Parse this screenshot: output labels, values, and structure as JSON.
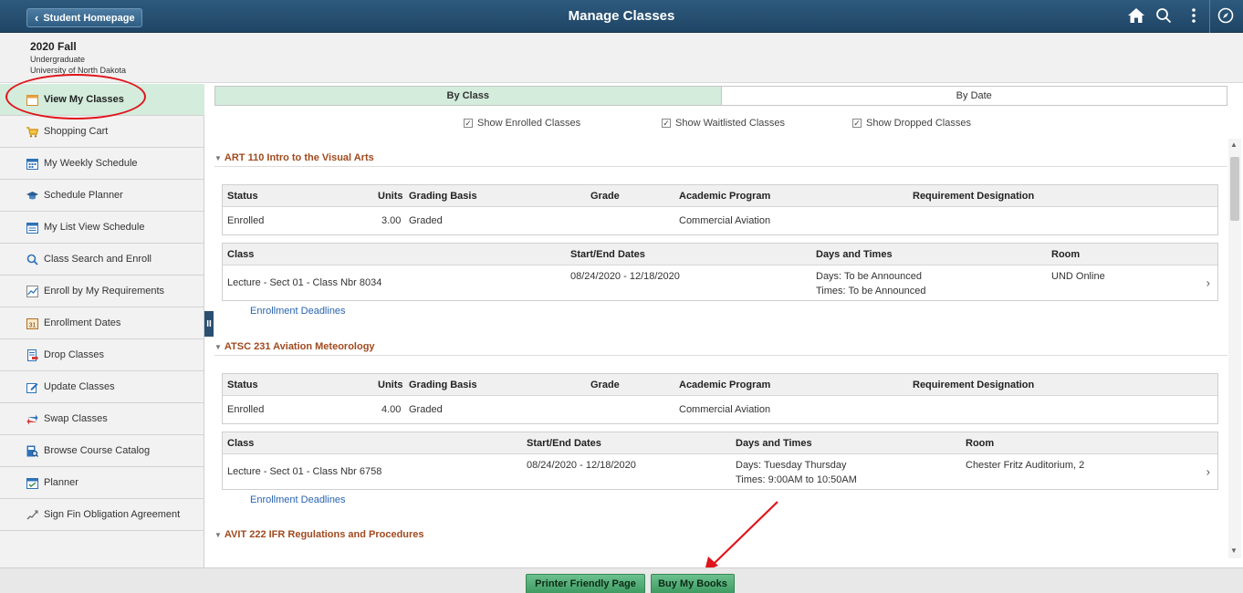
{
  "header": {
    "back_label": "Student Homepage",
    "title": "Manage Classes",
    "icons": [
      "home-icon",
      "search-icon",
      "more-vert-icon",
      "compass-icon"
    ]
  },
  "term": {
    "title": "2020 Fall",
    "career": "Undergraduate",
    "institution": "University of North Dakota"
  },
  "sidebar": {
    "items": [
      {
        "label": "View My Classes",
        "icon": "calendar-icon",
        "active": true
      },
      {
        "label": "Shopping Cart",
        "icon": "cart-icon"
      },
      {
        "label": "My Weekly Schedule",
        "icon": "calendar-grid-icon"
      },
      {
        "label": "Schedule Planner",
        "icon": "cap-icon"
      },
      {
        "label": "My List View Schedule",
        "icon": "calendar-list-icon"
      },
      {
        "label": "Class Search and Enroll",
        "icon": "search-icon"
      },
      {
        "label": "Enroll by My Requirements",
        "icon": "chart-line-icon"
      },
      {
        "label": "Enrollment Dates",
        "icon": "date-icon"
      },
      {
        "label": "Drop Classes",
        "icon": "drop-icon"
      },
      {
        "label": "Update Classes",
        "icon": "edit-icon"
      },
      {
        "label": "Swap Classes",
        "icon": "swap-icon"
      },
      {
        "label": "Browse Course Catalog",
        "icon": "catalog-icon"
      },
      {
        "label": "Planner",
        "icon": "planner-icon"
      },
      {
        "label": "Sign Fin Obligation Agreement",
        "icon": "sign-icon"
      }
    ]
  },
  "tabs": [
    {
      "label": "By Class",
      "active": true
    },
    {
      "label": "By Date",
      "active": false
    }
  ],
  "filters": [
    {
      "label": "Show Enrolled Classes",
      "checked": true
    },
    {
      "label": "Show Waitlisted Classes",
      "checked": true
    },
    {
      "label": "Show Dropped Classes",
      "checked": true
    }
  ],
  "status_headers": {
    "status": "Status",
    "units": "Units",
    "grading": "Grading Basis",
    "grade": "Grade",
    "program": "Academic Program",
    "requirement": "Requirement Designation"
  },
  "class_headers": {
    "class": "Class",
    "dates": "Start/End Dates",
    "days": "Days and Times",
    "room": "Room"
  },
  "courses": [
    {
      "title": "ART 110 Intro to the Visual Arts",
      "status": "Enrolled",
      "units": "3.00",
      "grading": "Graded",
      "grade": "",
      "program": "Commercial Aviation",
      "requirement": "",
      "class": "Lecture - Sect 01 - Class Nbr 8034",
      "dates": "08/24/2020 - 12/18/2020",
      "days": "Days: To be Announced",
      "times": "Times: To be Announced",
      "room": "UND Online",
      "link": "Enrollment Deadlines"
    },
    {
      "title": "ATSC 231 Aviation Meteorology",
      "status": "Enrolled",
      "units": "4.00",
      "grading": "Graded",
      "grade": "",
      "program": "Commercial Aviation",
      "requirement": "",
      "class": "Lecture - Sect 01 - Class Nbr 6758",
      "dates": "08/24/2020 - 12/18/2020",
      "days": "Days: Tuesday Thursday",
      "times": "Times: 9:00AM to 10:50AM",
      "room": "Chester Fritz Auditorium, 2",
      "link": "Enrollment Deadlines"
    },
    {
      "title": "AVIT 222 IFR Regulations and Procedures"
    }
  ],
  "footer": {
    "printer_label": "Printer Friendly Page",
    "books_label": "Buy My Books"
  },
  "colors": {
    "header_bg": "#1f4565",
    "accent_green": "#d3ecdc",
    "course_title": "#a04a1f",
    "link": "#2a64b0",
    "annotation_red": "#e0141a"
  }
}
